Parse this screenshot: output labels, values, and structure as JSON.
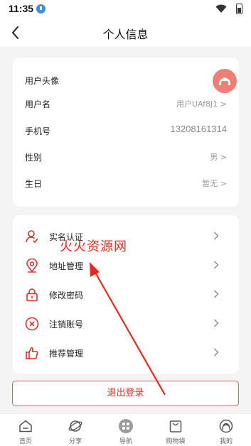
{
  "status_bar": {
    "time": "11:35"
  },
  "header": {
    "title": "个人信息"
  },
  "profile": {
    "avatar_label": "用户头像",
    "rows": [
      {
        "label": "用户名",
        "value": "用户UAf8J1 >"
      },
      {
        "label": "手机号",
        "value": "13208161314"
      },
      {
        "label": "性别",
        "value": "男 >"
      },
      {
        "label": "生日",
        "value": "暂无 >"
      }
    ]
  },
  "menu": [
    {
      "label": "实名认证",
      "icon": "user-verify-icon"
    },
    {
      "label": "地址管理",
      "icon": "location-pin-icon"
    },
    {
      "label": "修改密码",
      "icon": "lock-icon"
    },
    {
      "label": "注销账号",
      "icon": "cancel-circle-icon"
    },
    {
      "label": "推荐管理",
      "icon": "thumbs-up-icon"
    }
  ],
  "logout_label": "退出登录",
  "tabs": [
    {
      "label": "首页",
      "icon": "home-icon"
    },
    {
      "label": "分享",
      "icon": "share-planet-icon"
    },
    {
      "label": "导航",
      "icon": "grid-nav-icon"
    },
    {
      "label": "购物袋",
      "icon": "shopping-bag-icon"
    },
    {
      "label": "我的",
      "icon": "profile-icon"
    }
  ],
  "watermark": "火火资源网",
  "colors": {
    "accent": "#d9302a",
    "avatar_bg": "#ee7f78",
    "annotation": "#e8281e"
  }
}
